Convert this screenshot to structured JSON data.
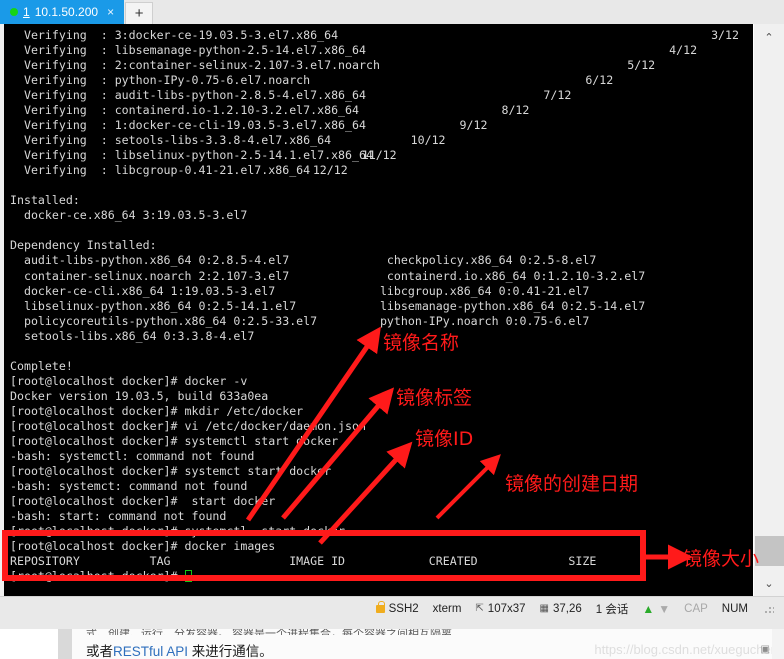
{
  "tab": {
    "index": "1",
    "title": "10.1.50.200",
    "close_label": "×",
    "new_tab_label": "+",
    "dot_color": "#17d417",
    "active_color": "#1a9ae8"
  },
  "terminal": {
    "background": "#000000",
    "foreground": "#d8d8d8",
    "cursor_color": "#14c814",
    "lines": [
      {
        "text": "  Verifying  : 3:docker-ce-19.03.5-3.el7.x86_64",
        "right": "3/12"
      },
      {
        "text": "  Verifying  : libsemanage-python-2.5-14.el7.x86_64",
        "right": "4/12"
      },
      {
        "text": "  Verifying  : 2:container-selinux-2.107-3.el7.noarch",
        "right": "5/12"
      },
      {
        "text": "  Verifying  : python-IPy-0.75-6.el7.noarch",
        "right": "6/12"
      },
      {
        "text": "  Verifying  : audit-libs-python-2.8.5-4.el7.x86_64",
        "right": "7/12"
      },
      {
        "text": "  Verifying  : containerd.io-1.2.10-3.2.el7.x86_64",
        "right": "8/12"
      },
      {
        "text": "  Verifying  : 1:docker-ce-cli-19.03.5-3.el7.x86_64",
        "right": "9/12"
      },
      {
        "text": "  Verifying  : setools-libs-3.3.8-4.el7.x86_64",
        "right": "10/12"
      },
      {
        "text": "  Verifying  : libselinux-python-2.5-14.1.el7.x86_64",
        "right": "11/12"
      },
      {
        "text": "  Verifying  : libcgroup-0.41-21.el7.x86_64",
        "right": "12/12"
      },
      {
        "text": "",
        "right": ""
      },
      {
        "text": "Installed:",
        "right": ""
      },
      {
        "text": "  docker-ce.x86_64 3:19.03.5-3.el7",
        "right": ""
      },
      {
        "text": "",
        "right": ""
      },
      {
        "text": "Dependency Installed:",
        "right": ""
      },
      {
        "text": "  audit-libs-python.x86_64 0:2.8.5-4.el7              checkpolicy.x86_64 0:2.5-8.el7",
        "right": ""
      },
      {
        "text": "  container-selinux.noarch 2:2.107-3.el7              containerd.io.x86_64 0:1.2.10-3.2.el7",
        "right": ""
      },
      {
        "text": "  docker-ce-cli.x86_64 1:19.03.5-3.el7               libcgroup.x86_64 0:0.41-21.el7",
        "right": ""
      },
      {
        "text": "  libselinux-python.x86_64 0:2.5-14.1.el7            libsemanage-python.x86_64 0:2.5-14.el7",
        "right": ""
      },
      {
        "text": "  policycoreutils-python.x86_64 0:2.5-33.el7         python-IPy.noarch 0:0.75-6.el7",
        "right": ""
      },
      {
        "text": "  setools-libs.x86_64 0:3.3.8-4.el7",
        "right": ""
      },
      {
        "text": "",
        "right": ""
      },
      {
        "text": "Complete!",
        "right": ""
      },
      {
        "text": "[root@localhost docker]# docker -v",
        "right": ""
      },
      {
        "text": "Docker version 19.03.5, build 633a0ea",
        "right": ""
      },
      {
        "text": "[root@localhost docker]# mkdir /etc/docker",
        "right": ""
      },
      {
        "text": "[root@localhost docker]# vi /etc/docker/daemon.json",
        "right": ""
      },
      {
        "text": "[root@localhost docker]# systemctl start docker",
        "right": ""
      },
      {
        "text": "-bash: systemctl: command not found",
        "right": ""
      },
      {
        "text": "[root@localhost docker]# systemct start docker",
        "right": ""
      },
      {
        "text": "-bash: systemct: command not found",
        "right": ""
      },
      {
        "text": "[root@localhost docker]#  start docker",
        "right": ""
      },
      {
        "text": "-bash: start: command not found",
        "right": ""
      },
      {
        "text": "[root@localhost docker]# systemctl  start docker",
        "right": ""
      },
      {
        "text": "[root@localhost docker]# docker images",
        "right": ""
      },
      {
        "text": "REPOSITORY          TAG                 IMAGE ID            CREATED             SIZE",
        "right": ""
      }
    ],
    "prompt_last": "[root@localhost docker]# ",
    "scrollbar": {
      "up": "⌃",
      "down": "⌄"
    }
  },
  "annotations": {
    "color": "#ff1a1a",
    "labels": [
      {
        "id": "image-name",
        "text": "镜像名称"
      },
      {
        "id": "image-tag",
        "text": "镜像标签"
      },
      {
        "id": "image-id",
        "text": "镜像ID"
      },
      {
        "id": "image-created",
        "text": "镜像的创建日期"
      },
      {
        "id": "image-size",
        "text": "镜像大小"
      }
    ]
  },
  "statusbar": {
    "protocol": "SSH2",
    "terminal_type": "xterm",
    "dimensions": "107x37",
    "cursor_position": "37,26",
    "sessions": "1 会话",
    "caps": "CAP",
    "num": "NUM",
    "size_icon_label": "⇱"
  },
  "document": {
    "cut_line": "式、创建、运行、分发容器。  容器是一个进程集合，每个容器之间相互隔离",
    "text_prefix": "或者",
    "text_kw": "RESTful API",
    "text_suffix": " 来进行通信。",
    "watermark": "https://blog.csdn.net/xueguchen"
  }
}
